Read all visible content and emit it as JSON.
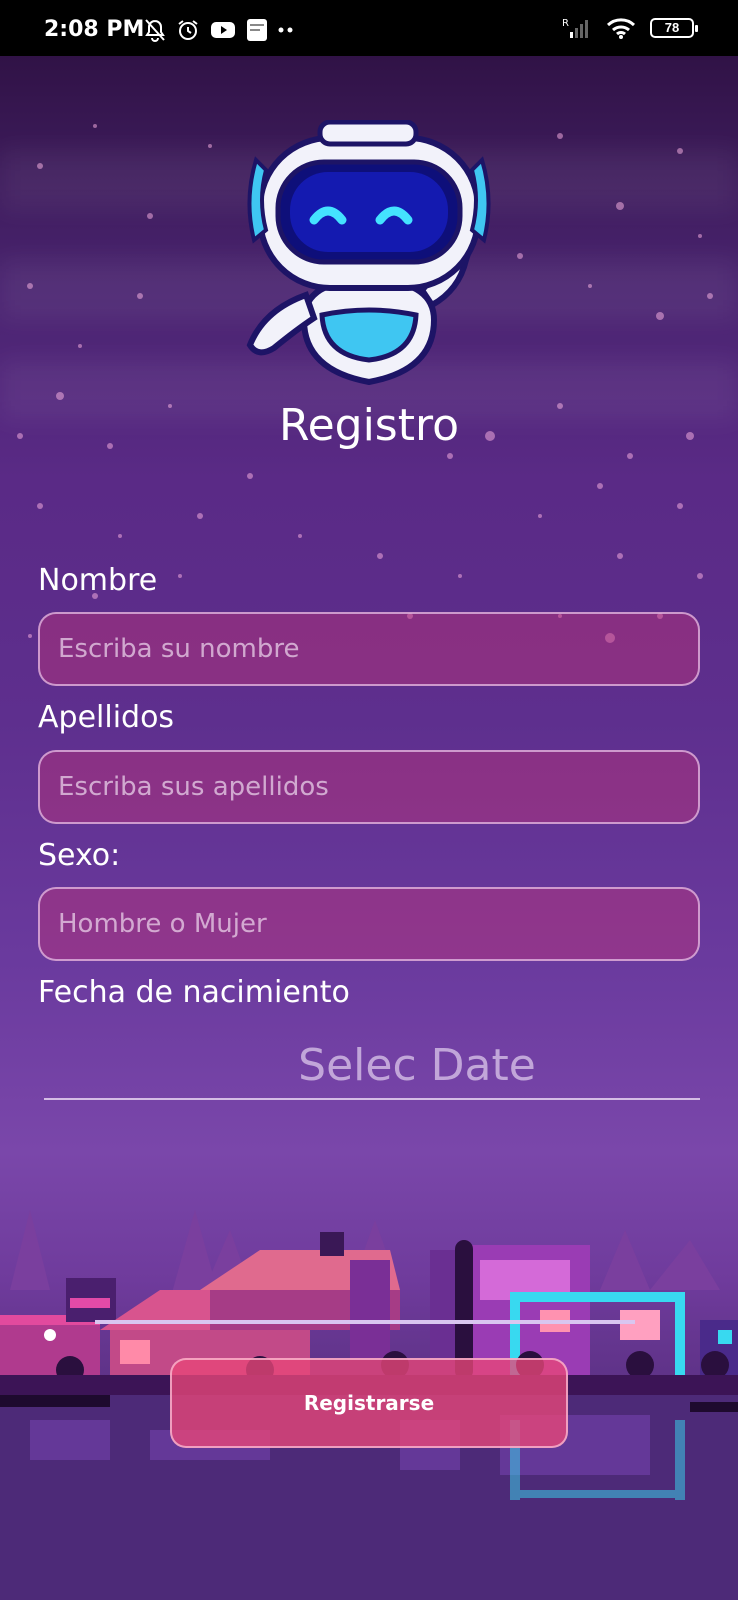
{
  "status_bar": {
    "time": "2:08 PM",
    "left_icons": [
      "bell-off-icon",
      "alarm-icon",
      "youtube-icon",
      "app-notification-icon",
      "more-dots-icon"
    ],
    "right_icons": [
      "signal-icon",
      "wifi-icon",
      "battery-icon"
    ],
    "battery_level": "78"
  },
  "header": {
    "title": "Registro",
    "mascot_icon": "robot-mascot-icon"
  },
  "form": {
    "nombre": {
      "label": "Nombre",
      "placeholder": "Escriba su nombre",
      "value": ""
    },
    "apellidos": {
      "label": "Apellidos",
      "placeholder": "Escriba sus apellidos",
      "value": ""
    },
    "sexo": {
      "label": "Sexo:",
      "placeholder": "Hombre o Mujer",
      "value": ""
    },
    "fecha": {
      "label": "Fecha de nacimiento",
      "date_text": "Selec Date"
    }
  },
  "actions": {
    "register_label": "Registrarse"
  },
  "colors": {
    "accent": "#e8467a",
    "background_top": "#2a0e3c",
    "background_mid": "#5e2f8e",
    "field_fill": "#be3278"
  }
}
